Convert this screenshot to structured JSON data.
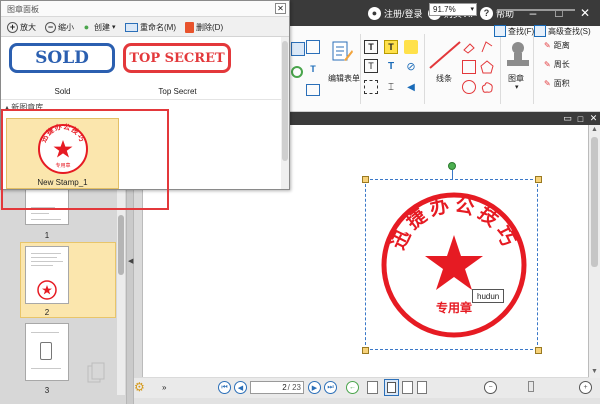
{
  "titlebar": {
    "register_login": "注册/登录",
    "buy_vip": "购买VIP",
    "help": "帮助"
  },
  "ribbon": {
    "find": "查找(F)",
    "advanced_find": "高级查找(S)",
    "edit_form": "编辑表单",
    "lines": "线条",
    "stamp": "图章",
    "distance": "距离",
    "perimeter": "周长",
    "area": "面积"
  },
  "popup": {
    "title": "图章面板",
    "toolbar": {
      "zoom_in": "放大",
      "zoom_out": "缩小",
      "create": "创建",
      "rename": "重命名(M)",
      "delete": "删除(D)"
    },
    "stamps": [
      {
        "image_text": "SOLD",
        "caption": "Sold"
      },
      {
        "image_text": "TOP SECRET",
        "caption": "Top Secret"
      }
    ],
    "group_header": "▴ 新图章库",
    "new_stamp": {
      "caption": "New Stamp_1",
      "top_text": "迅捷办公技巧",
      "bottom_text": "专用章"
    }
  },
  "thumbnails": {
    "pages": [
      "1",
      "2",
      "3"
    ],
    "selected_page": "2"
  },
  "document": {
    "stamp_top_text": "迅捷办公技巧",
    "stamp_bottom_text": "专用章",
    "tooltip": "hudun"
  },
  "bottombar": {
    "current_page": "2",
    "total_pages": "/ 23",
    "zoom": "91.7%"
  },
  "colors": {
    "stamp_red": "#e61b23",
    "sold_blue": "#2b5fb0",
    "selection_yellow": "#fbe6ad",
    "highlight_red": "#e3383b",
    "titlebar": "#3a3a3a"
  }
}
